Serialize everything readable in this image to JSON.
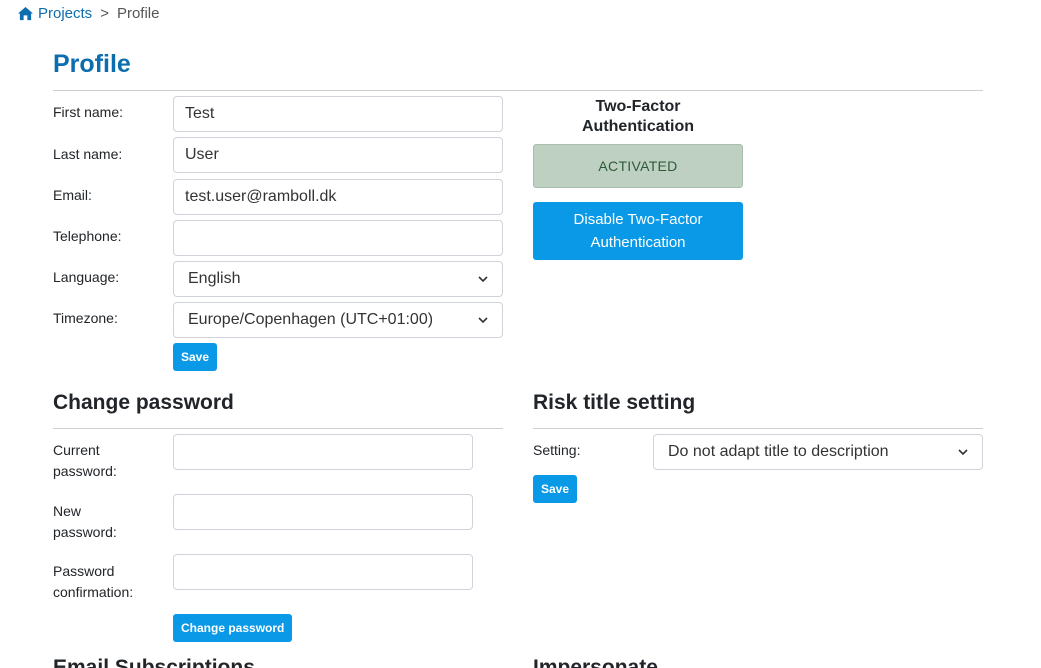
{
  "breadcrumb": {
    "home_label": "Projects",
    "separator": ">",
    "current": "Profile",
    "home_icon": "home-icon"
  },
  "page": {
    "title": "Profile"
  },
  "profile_form": {
    "first_name_label": "First name:",
    "first_name_value": "Test",
    "last_name_label": "Last name:",
    "last_name_value": "User",
    "email_label": "Email:",
    "email_value": "test.user@ramboll.dk",
    "telephone_label": "Telephone:",
    "telephone_value": "",
    "language_label": "Language:",
    "language_value": "English",
    "timezone_label": "Timezone:",
    "timezone_value": "Europe/Copenhagen (UTC+01:00)",
    "save_label": "Save"
  },
  "two_factor": {
    "heading_line1": "Two-Factor",
    "heading_line2": "Authentication",
    "status": "ACTIVATED",
    "disable_line1": "Disable Two-Factor",
    "disable_line2": "Authentication",
    "status_color": "#bed0c2"
  },
  "change_password": {
    "title": "Change password",
    "current_label_1": "Current",
    "current_label_2": "password:",
    "new_label_1": "New",
    "new_label_2": "password:",
    "confirm_label_1": "Password",
    "confirm_label_2": "confirmation:",
    "button_label": "Change password"
  },
  "risk_title": {
    "title": "Risk title setting",
    "setting_label": "Setting:",
    "setting_value": "Do not adapt title to description",
    "save_label": "Save"
  },
  "partial_sections": {
    "left_title": "Email Subscriptions",
    "right_title": "Impersonate"
  },
  "colors": {
    "accent": "#0a99e6",
    "title_blue": "#0d6eaf"
  }
}
